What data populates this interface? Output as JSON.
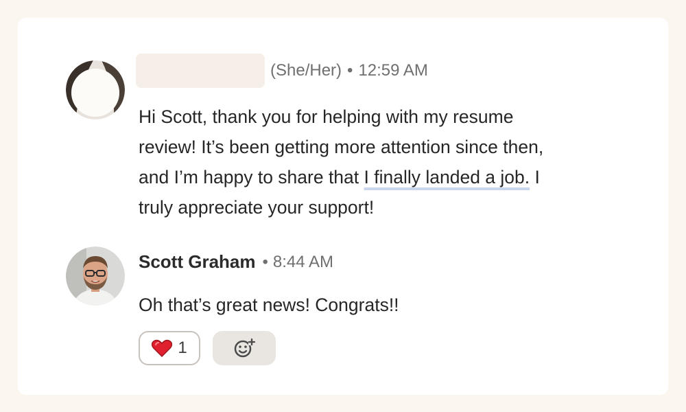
{
  "colors": {
    "background": "#fbf6f0",
    "card": "#ffffff",
    "highlight_underline": "#c9d6ee",
    "heart": "#e0202e"
  },
  "messages": [
    {
      "pronouns": "(She/Her)",
      "separator": "•",
      "time": "12:59 AM",
      "text_before": "Hi Scott, thank you for helping with my resume",
      "text_line2": "review! It’s been getting more attention since then,",
      "text_line3_before": "and I’m happy to share that ",
      "text_highlight": "I finally landed a job.",
      "text_line3_after": " I",
      "text_line4": "truly appreciate your support!"
    },
    {
      "sender": "Scott Graham",
      "separator": "•",
      "time": "8:44 AM",
      "text": "Oh that’s great news! Congrats!!",
      "reactions": {
        "heart_icon": "heart-icon",
        "heart_count": "1",
        "add_reaction_icon": "add-emoji-icon"
      }
    }
  ]
}
